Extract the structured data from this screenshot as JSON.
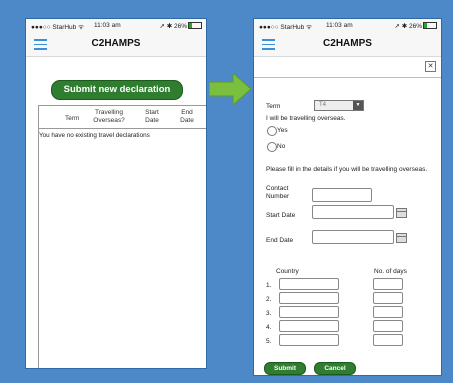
{
  "status_bar": {
    "carrier": "●●●○○ StarHub ᯤ",
    "time": "11:03 am",
    "battery": "➚ ✱ 26%"
  },
  "app": {
    "title": "C2HAMPS"
  },
  "left": {
    "submit_button": "Submit new declaration",
    "table": {
      "headers": [
        "Term",
        "Travelling Overseas?",
        "Start Date",
        "End Date"
      ],
      "empty_message": "You have no existing travel declarations"
    }
  },
  "right": {
    "close_icon": "✕",
    "term_label": "Term",
    "term_value": "T4",
    "question": "I will be travelling overseas.",
    "options": [
      "Yes",
      "No"
    ],
    "instructions": "Please fill in the details if you will be travelling overseas.",
    "contact_label": "Contact Number",
    "start_date_label": "Start Date",
    "end_date_label": "End Date",
    "country_header": "Country",
    "days_header": "No. of days",
    "row_numbers": [
      "1.",
      "2.",
      "3.",
      "4.",
      "5."
    ],
    "submit_button": "Submit",
    "cancel_button": "Cancel"
  },
  "colors": {
    "background": "#4d88c9",
    "accent_green": "#2f7d2f",
    "arrow_green": "#7bbf3f",
    "menu_blue": "#3a8fd8"
  },
  "icons": [
    "menu-icon",
    "battery-icon",
    "wifi-icon",
    "close-icon",
    "calendar-icon",
    "right-arrow-icon"
  ]
}
